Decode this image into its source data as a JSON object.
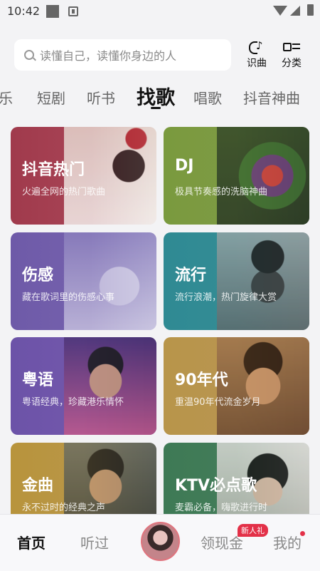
{
  "status_bar": {
    "time": "10:42"
  },
  "search": {
    "placeholder": "读懂自己，读懂你身边的人"
  },
  "top_actions": {
    "identify": "识曲",
    "category": "分类"
  },
  "tabs": [
    "乐",
    "短剧",
    "听书",
    "找歌",
    "唱歌",
    "抖音神曲"
  ],
  "active_tab": "找歌",
  "cards": [
    {
      "title": "抖音热门",
      "subtitle": "火遍全网的热门歌曲",
      "color": "#a84456"
    },
    {
      "title": "DJ",
      "subtitle": "极具节奏感的洗脑神曲",
      "color": "#7e9b44"
    },
    {
      "title": "伤感",
      "subtitle": "藏在歌词里的伤感心事",
      "color": "#7561ad"
    },
    {
      "title": "流行",
      "subtitle": "流行浪潮，热门旋律大赏",
      "color": "#348c95"
    },
    {
      "title": "粤语",
      "subtitle": "粤语经典，珍藏港乐情怀",
      "color": "#7257ab"
    },
    {
      "title": "90年代",
      "subtitle": "重温90年代流金岁月",
      "color": "#b99550"
    },
    {
      "title": "金曲",
      "subtitle": "永不过时的经典之声",
      "color": "#b99647"
    },
    {
      "title": "KTV必点歌",
      "subtitle": "麦霸必备，嗨歌进行时",
      "color": "#437c59"
    }
  ],
  "bottom_nav": {
    "home": "首页",
    "history": "听过",
    "rewards": "领现金",
    "reward_badge": "新人礼",
    "me": "我的"
  }
}
